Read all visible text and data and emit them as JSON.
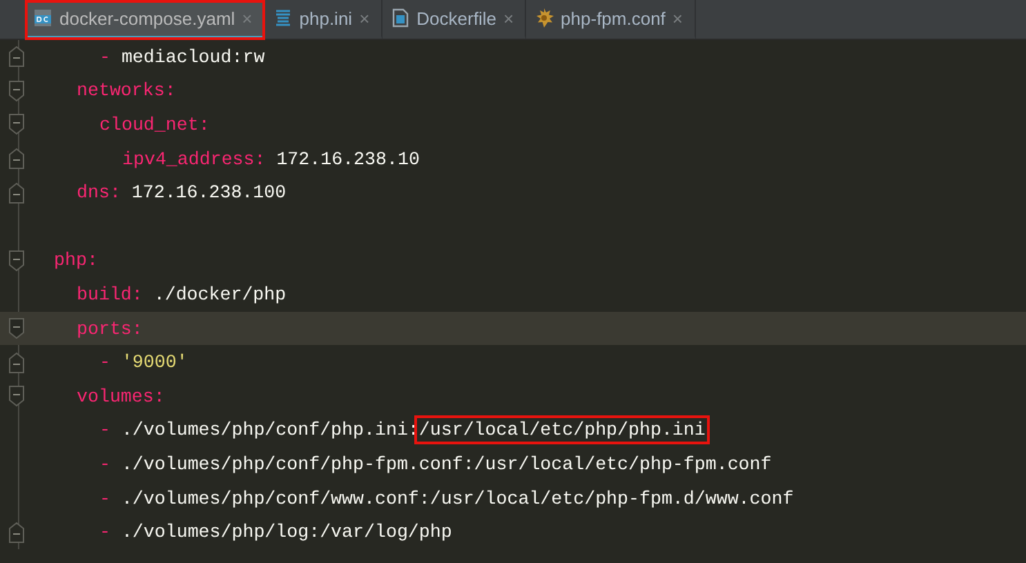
{
  "tabs": [
    {
      "label": "docker-compose.yaml",
      "kind": "yaml",
      "selected": true,
      "boxed": true,
      "close": "×"
    },
    {
      "label": "php.ini",
      "kind": "ini",
      "selected": false,
      "boxed": false,
      "close": "×"
    },
    {
      "label": "Dockerfile",
      "kind": "docker",
      "selected": false,
      "boxed": false,
      "close": "×"
    },
    {
      "label": "php-fpm.conf",
      "kind": "conf",
      "selected": false,
      "boxed": false,
      "close": "×"
    }
  ],
  "editor": {
    "lines": [
      {
        "children": [
          {
            "children": [
              {
                "fold_marker": true,
                "tokens": [
                  {
                    "kind": "dash",
                    "text": "-"
                  },
                  {
                    "kind": "value",
                    "text": "mediacloud:rw"
                  }
                ]
              }
            ]
          },
          {
            "fold_marker": true,
            "tokens": [
              {
                "kind": "key",
                "text": "networks:"
              }
            ],
            "children": [
              {
                "fold_marker": true,
                "tokens": [
                  {
                    "kind": "key",
                    "text": "cloud_net:"
                  }
                ],
                "children": [
                  {
                    "fold_marker": true,
                    "tokens": [
                      {
                        "kind": "key",
                        "text": "ipv4_address:"
                      },
                      {
                        "kind": "value",
                        "text": "172.16.238.10"
                      }
                    ]
                  }
                ]
              }
            ]
          },
          {
            "fold_marker": true,
            "tokens": [
              {
                "kind": "key",
                "text": "dns:"
              },
              {
                "kind": "value",
                "text": "172.16.238.100"
              }
            ]
          }
        ]
      },
      {
        "blank": true
      },
      {
        "fold_marker": true,
        "tokens": [
          {
            "kind": "key",
            "text": "php:"
          }
        ],
        "children": [
          {
            "tokens": [
              {
                "kind": "key",
                "text": "build:"
              },
              {
                "kind": "value",
                "text": "./docker/php"
              }
            ]
          },
          {
            "fold_marker": true,
            "current": true,
            "tokens": [
              {
                "kind": "key",
                "text": "ports:"
              }
            ],
            "children": [
              {
                "fold_marker": true,
                "tokens": [
                  {
                    "kind": "dash",
                    "text": "-"
                  },
                  {
                    "kind": "string",
                    "text": "'9000'"
                  }
                ]
              }
            ]
          },
          {
            "fold_marker": true,
            "tokens": [
              {
                "kind": "key",
                "text": "volumes:"
              }
            ],
            "children": [
              {
                "tokens": [
                  {
                    "kind": "dash",
                    "text": "-"
                  },
                  {
                    "kind": "value",
                    "text": "./volumes/php/conf/php.ini:",
                    "joined": true
                  },
                  {
                    "kind": "value",
                    "text": "/usr/local/etc/php/php.ini",
                    "boxed": true
                  }
                ]
              },
              {
                "tokens": [
                  {
                    "kind": "dash",
                    "text": "-"
                  },
                  {
                    "kind": "value",
                    "text": "./volumes/php/conf/php-fpm.conf:/usr/local/etc/php-fpm.conf"
                  }
                ]
              },
              {
                "tokens": [
                  {
                    "kind": "dash",
                    "text": "-"
                  },
                  {
                    "kind": "value",
                    "text": "./volumes/php/conf/www.conf:/usr/local/etc/php-fpm.d/www.conf"
                  }
                ]
              },
              {
                "fold_marker": true,
                "tokens": [
                  {
                    "kind": "dash",
                    "text": "-"
                  },
                  {
                    "kind": "value",
                    "text": "./volumes/php/log:/var/log/php"
                  }
                ]
              }
            ]
          }
        ]
      }
    ]
  }
}
